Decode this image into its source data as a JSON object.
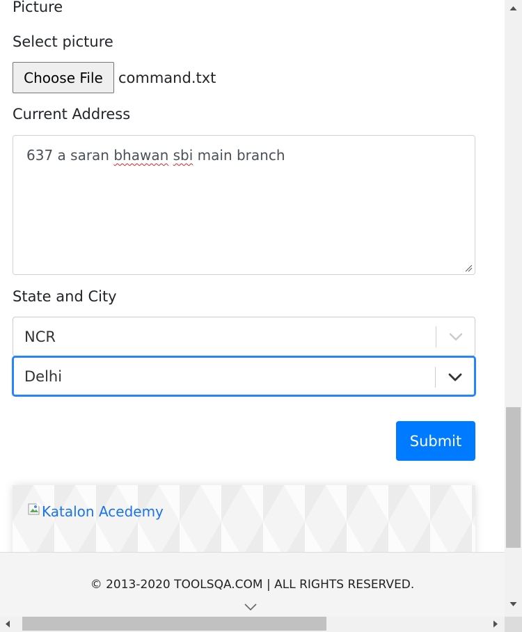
{
  "form": {
    "picture_label": "Picture",
    "select_picture_label": "Select picture",
    "choose_file_label": "Choose File",
    "file_name": "command.txt",
    "current_address_label": "Current Address",
    "address_parts": [
      "637 a saran ",
      "bhawan",
      " ",
      "sbi",
      " main branch"
    ],
    "state_city_label": "State and City",
    "state_value": "NCR",
    "city_value": "Delhi",
    "submit_label": "Submit"
  },
  "banner": {
    "alt_text": "Katalon Acedemy"
  },
  "footer": {
    "copyright": "© 2013-2020 TOOLSQA.COM | ALL RIGHTS RESERVED."
  },
  "colors": {
    "primary": "#007bff",
    "focus_border": "#2684ff",
    "link": "#1a73e8",
    "spellcheck": "#e02020"
  },
  "icons": {
    "select_dropdown": "chevron-down-icon",
    "footer_scroll": "chevron-down-icon",
    "broken_image": "broken-image-icon",
    "resize": "resize-grip-icon"
  },
  "scroll": {
    "vertical_position": 0.97,
    "horizontal_position": 0.05
  }
}
